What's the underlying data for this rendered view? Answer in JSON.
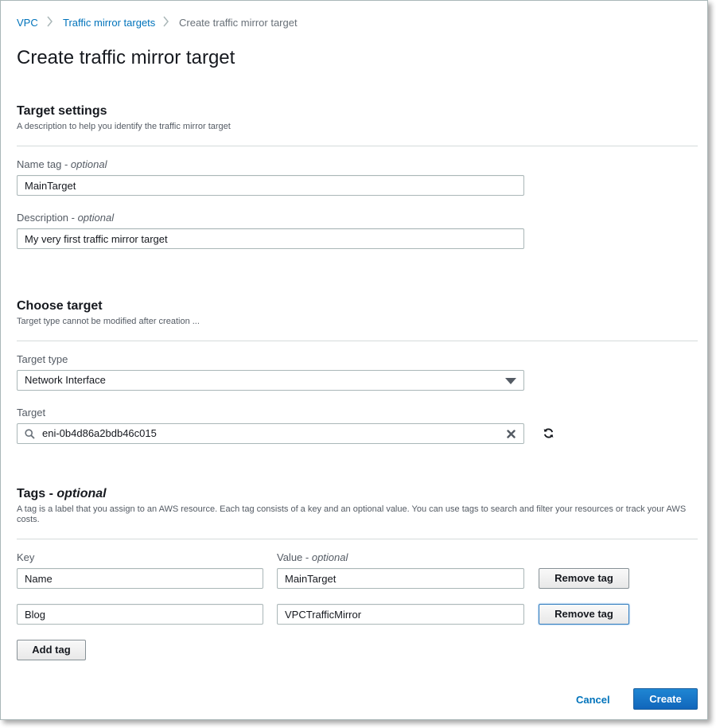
{
  "breadcrumb": {
    "items": [
      "VPC",
      "Traffic mirror targets",
      "Create traffic mirror target"
    ]
  },
  "page": {
    "title": "Create traffic mirror target"
  },
  "target_settings": {
    "title": "Target settings",
    "description": "A description to help you identify the traffic mirror target",
    "name_tag_label": "Name tag - ",
    "name_tag_optional": "optional",
    "name_tag_value": "MainTarget",
    "description_label": "Description - ",
    "description_optional": "optional",
    "description_value": "My very first traffic mirror target"
  },
  "choose_target": {
    "title": "Choose target",
    "description": "Target type cannot be modified after creation ...",
    "target_type_label": "Target type",
    "target_type_value": "Network Interface",
    "target_label": "Target",
    "target_value": "eni-0b4d86a2bdb46c015"
  },
  "tags": {
    "title": "Tags - ",
    "title_optional": "optional",
    "description": "A tag is a label that you assign to an AWS resource. Each tag consists of a key and an optional value. You can use tags to search and filter your resources or track your AWS costs.",
    "key_header": "Key",
    "value_header": "Value - ",
    "value_optional": "optional",
    "rows": [
      {
        "key": "Name",
        "value": "MainTarget",
        "remove_label": "Remove tag"
      },
      {
        "key": "Blog",
        "value": "VPCTrafficMirror",
        "remove_label": "Remove tag"
      }
    ],
    "add_label": "Add tag"
  },
  "footer": {
    "cancel_label": "Cancel",
    "create_label": "Create"
  },
  "icons": {
    "search": "search-icon",
    "clear": "close-icon",
    "refresh": "refresh-icon",
    "dropdown": "caret-down-icon",
    "breadcrumb_separator": "chevron-right-icon"
  },
  "colors": {
    "link": "#0073bb",
    "primary": "#1a73c4",
    "text": "#16191f",
    "muted": "#545b64"
  }
}
